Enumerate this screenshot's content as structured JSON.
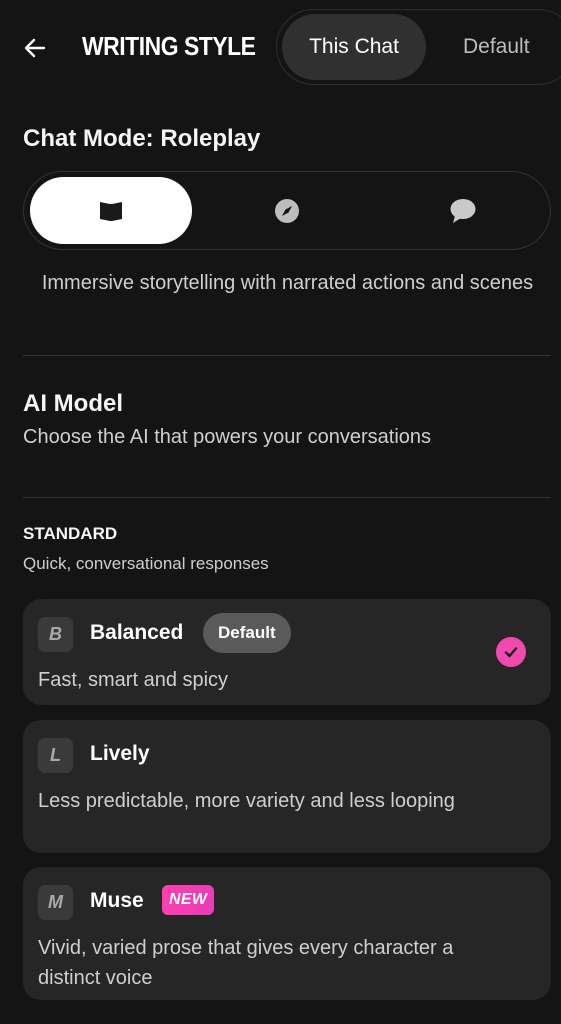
{
  "header": {
    "title": "WRITING STYLE",
    "tabs": [
      {
        "label": "This Chat",
        "active": true
      },
      {
        "label": "Default",
        "active": false
      }
    ]
  },
  "chat_mode": {
    "heading": "Chat Mode: Roleplay",
    "options": [
      {
        "icon": "book-icon",
        "selected": true
      },
      {
        "icon": "compass-icon",
        "selected": false
      },
      {
        "icon": "chat-bubble-icon",
        "selected": false
      }
    ],
    "description": "Immersive storytelling with narrated actions and scenes"
  },
  "ai_model": {
    "heading": "AI Model",
    "subtitle": "Choose the AI that powers your conversations",
    "tier": {
      "label": "STANDARD",
      "subtitle": "Quick, conversational responses"
    },
    "models": [
      {
        "letter": "B",
        "name": "Balanced",
        "badge": "Default",
        "description": "Fast, smart and spicy",
        "selected": true
      },
      {
        "letter": "L",
        "name": "Lively",
        "description": "Less predictable, more variety and less looping",
        "selected": false
      },
      {
        "letter": "M",
        "name": "Muse",
        "badge": "NEW",
        "description": "Vivid, varied prose that gives every character a distinct voice",
        "selected": false
      }
    ]
  },
  "colors": {
    "background": "#141414",
    "card": "#262626",
    "accent_pink": "#f04ab0"
  }
}
